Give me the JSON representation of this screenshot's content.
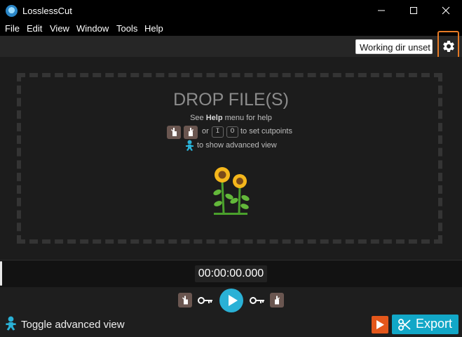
{
  "window": {
    "title": "LosslessCut"
  },
  "menu": [
    "File",
    "Edit",
    "View",
    "Window",
    "Tools",
    "Help"
  ],
  "toolbar": {
    "working_dir": "Working dir unset"
  },
  "dropzone": {
    "title": "DROP FILE(S)",
    "help_prefix": "See",
    "help_bold": "Help",
    "help_suffix": "menu for help",
    "or_text": "or",
    "key_in": "I",
    "key_out": "O",
    "cutpoints_text": "to set cutpoints",
    "advanced_text": "to show advanced view"
  },
  "timeline": {
    "timecode": "00:00:00.000"
  },
  "bottom": {
    "toggle_label": "Toggle advanced view",
    "export_label": "Export"
  },
  "colors": {
    "accent": "#2ab1d6",
    "export": "#12a7c7",
    "orange": "#e4571b",
    "highlight": "#e67a25"
  }
}
